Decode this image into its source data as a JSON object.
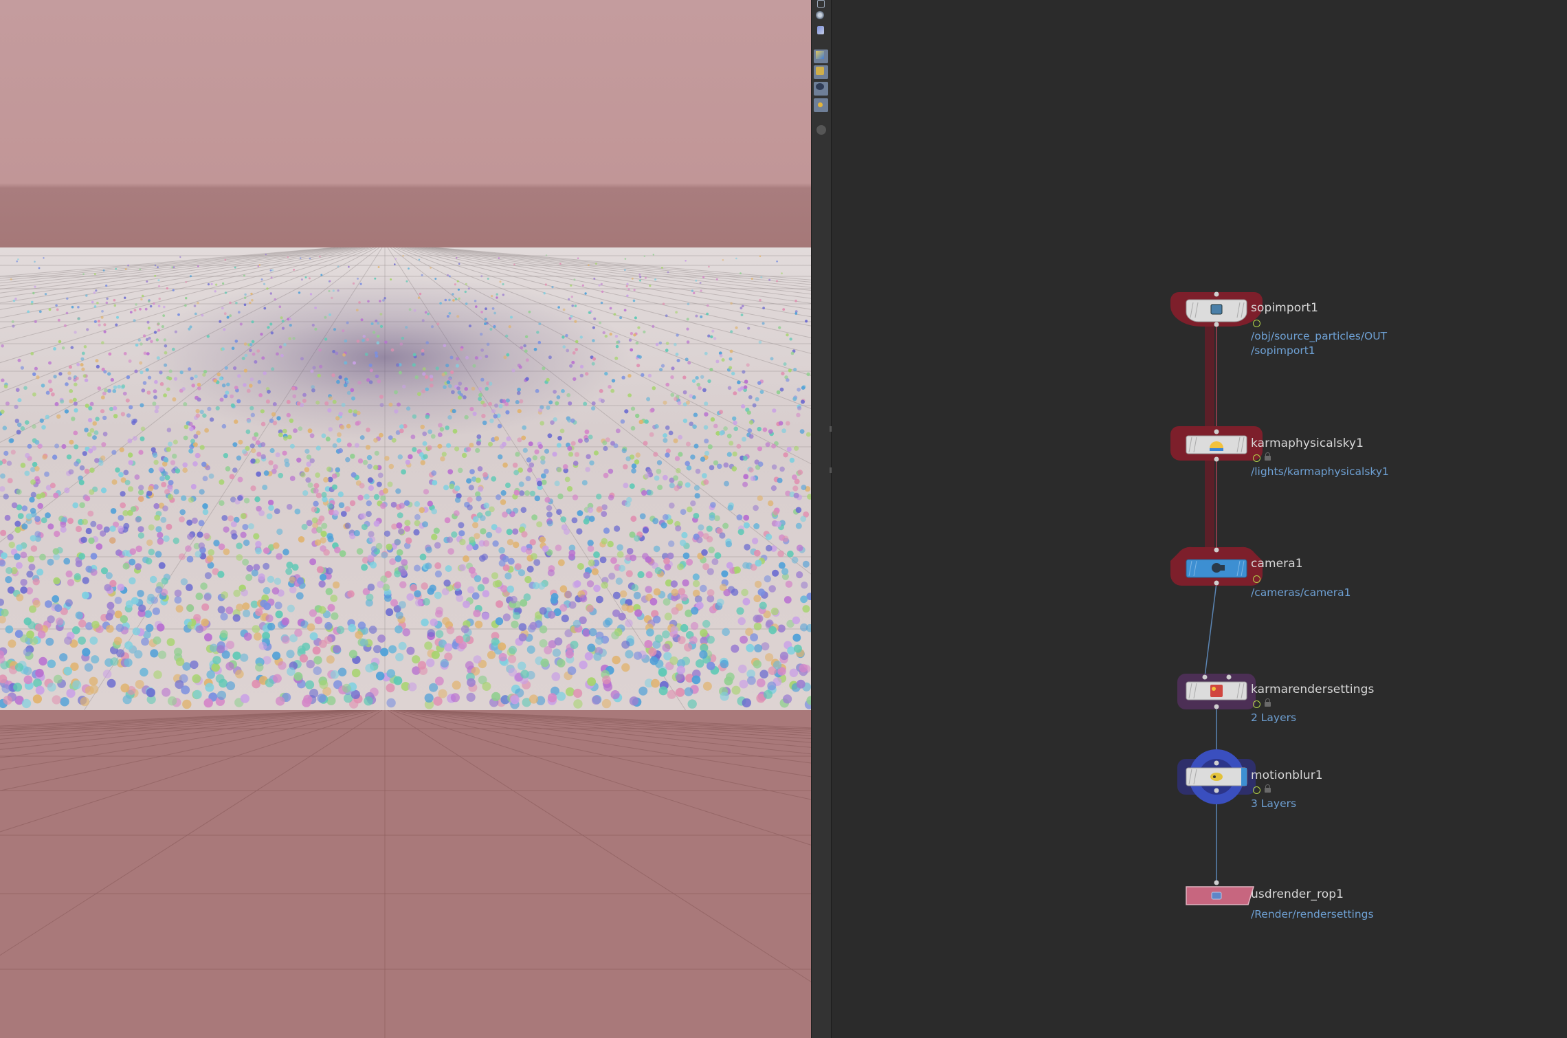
{
  "viewport": {
    "toolbar_tools": [
      "display-options-icon",
      "camera-menu-icon",
      "light-tool-icon",
      "ghost-geometry-icon",
      "shading-icon",
      "background-icon",
      "render-region-icon",
      "snapshot-icon"
    ]
  },
  "network": {
    "nodes": [
      {
        "name": "sopimport1",
        "paths": [
          "/obj/source_particles/OUT",
          "/sopimport1"
        ],
        "flags": [
          "display"
        ]
      },
      {
        "name": "karmaphysicalsky1",
        "paths": [
          "/lights/karmaphysicalsky1"
        ],
        "flags": [
          "display",
          "lock"
        ]
      },
      {
        "name": "camera1",
        "paths": [
          "/cameras/camera1"
        ],
        "flags": [
          "display"
        ]
      },
      {
        "name": "karmarendersettings",
        "paths": [
          "2 Layers"
        ],
        "flags": [
          "display",
          "lock"
        ]
      },
      {
        "name": "motionblur1",
        "paths": [
          "3 Layers"
        ],
        "flags": [
          "display",
          "lock"
        ]
      },
      {
        "name": "usdrender_rop1",
        "paths": [
          "/Render/rendersettings"
        ],
        "flags": []
      }
    ]
  },
  "colors": {
    "sky": "#c49c9e",
    "ground": "#a9797a",
    "plane": "#dfd6d6",
    "wire_selected": "#8a2432",
    "wire": "#5b86b5",
    "node_highlight_red": "#7d1f2b",
    "node_highlight_purple": "#4c2f55",
    "node_highlight_blue": "#3a4fbf",
    "rop_pink": "#c7667f"
  }
}
